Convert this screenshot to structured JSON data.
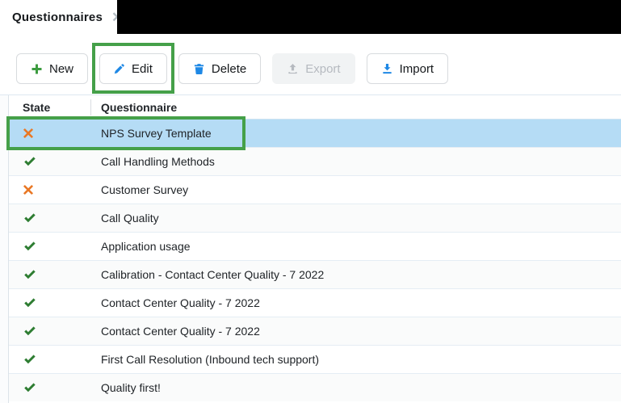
{
  "tab": {
    "label": "Questionnaires",
    "close_glyph": "✕"
  },
  "toolbar": {
    "buttons": [
      {
        "label": "New",
        "icon": "plus-icon",
        "enabled": true,
        "annotated": false
      },
      {
        "label": "Edit",
        "icon": "pencil-icon",
        "enabled": true,
        "annotated": true
      },
      {
        "label": "Delete",
        "icon": "trash-icon",
        "enabled": true,
        "annotated": false
      },
      {
        "label": "Export",
        "icon": "upload-icon",
        "enabled": false,
        "annotated": false
      },
      {
        "label": "Import",
        "icon": "download-icon",
        "enabled": true,
        "annotated": false
      }
    ]
  },
  "table": {
    "columns": [
      "State",
      "Questionnaire"
    ],
    "rows": [
      {
        "state": "fail",
        "name": "NPS Survey Template",
        "selected": true,
        "annotated": true
      },
      {
        "state": "pass",
        "name": "Call Handling Methods"
      },
      {
        "state": "fail",
        "name": "Customer Survey"
      },
      {
        "state": "pass",
        "name": "Call Quality"
      },
      {
        "state": "pass",
        "name": "Application usage"
      },
      {
        "state": "pass",
        "name": "Calibration - Contact Center Quality - 7 2022"
      },
      {
        "state": "pass",
        "name": "Contact Center Quality - 7 2022"
      },
      {
        "state": "pass",
        "name": "Contact Center Quality - 7 2022"
      },
      {
        "state": "pass",
        "name": "First Call Resolution (Inbound tech support)"
      },
      {
        "state": "pass",
        "name": "Quality first!"
      }
    ]
  },
  "colors": {
    "annotation_green": "#45a049",
    "selected_row_blue": "#b5dcf5",
    "pass_green": "#2e7d32",
    "fail_orange": "#e97825",
    "icon_blue": "#1e88e5",
    "plus_green": "#3d9c40",
    "black_bar": "#000000"
  }
}
